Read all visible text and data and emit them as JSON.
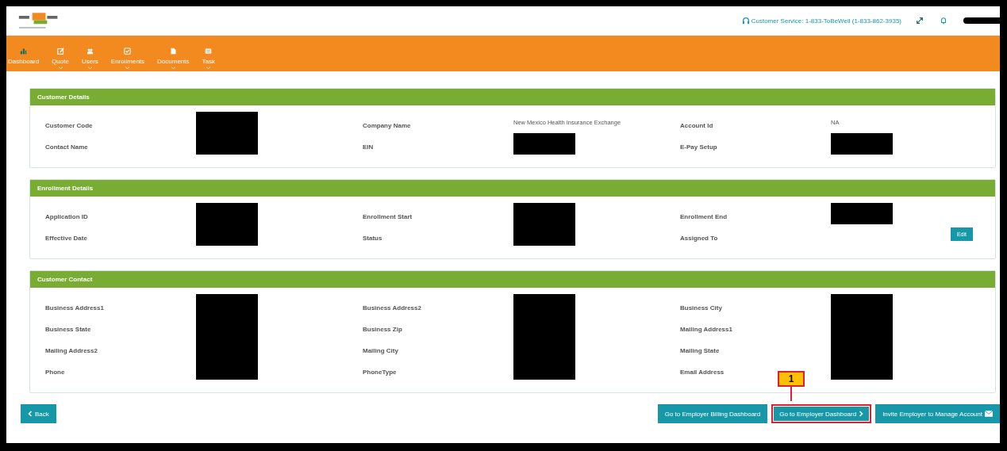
{
  "header": {
    "customer_service": "Customer Service: 1-833-ToBeWell (1-833-862-3935)",
    "user_redacted": true
  },
  "nav": [
    {
      "label": "Dashboard",
      "dropdown": false
    },
    {
      "label": "Quote",
      "dropdown": true
    },
    {
      "label": "Users",
      "dropdown": true
    },
    {
      "label": "Enrollments",
      "dropdown": true
    },
    {
      "label": "Documents",
      "dropdown": true
    },
    {
      "label": "Task",
      "dropdown": true
    }
  ],
  "sections": [
    {
      "title": "Customer Details",
      "rows": [
        [
          {
            "label": "Customer Code",
            "redacted": true
          },
          {
            "label": "Company Name",
            "value": "New Mexico Health Insurance Exchange",
            "redacted": false
          },
          {
            "label": "Account Id",
            "value": "NA",
            "redacted": false
          }
        ],
        [
          {
            "label": "Contact Name",
            "redacted": true
          },
          {
            "label": "EIN",
            "redacted": true
          },
          {
            "label": "E-Pay Setup",
            "redacted": true
          }
        ]
      ]
    },
    {
      "title": "Enrollment Details",
      "action": "Edit",
      "rows": [
        [
          {
            "label": "Application ID",
            "redacted": true
          },
          {
            "label": "Enrollment Start",
            "redacted": true
          },
          {
            "label": "Enrollment End",
            "redacted": true
          }
        ],
        [
          {
            "label": "Effective Date",
            "redacted": true
          },
          {
            "label": "Status",
            "redacted": true
          },
          {
            "label": "Assigned To",
            "redacted": false
          }
        ]
      ]
    },
    {
      "title": "Customer Contact",
      "rows": [
        [
          {
            "label": "Business Address1",
            "redacted": true
          },
          {
            "label": "Business Address2",
            "redacted": true
          },
          {
            "label": "Business City",
            "redacted": true
          }
        ],
        [
          {
            "label": "Business State",
            "redacted": true
          },
          {
            "label": "Business Zip",
            "redacted": true
          },
          {
            "label": "Mailing Address1",
            "redacted": true
          }
        ],
        [
          {
            "label": "Mailing Address2",
            "redacted": true
          },
          {
            "label": "Mailing City",
            "redacted": true
          },
          {
            "label": "Mailing State",
            "redacted": true
          }
        ],
        [
          {
            "label": "Phone",
            "redacted": true
          },
          {
            "label": "PhoneType",
            "redacted": true
          },
          {
            "label": "Email Address",
            "redacted": true
          }
        ]
      ]
    }
  ],
  "footer": {
    "back": {
      "label": "Back"
    },
    "buttons": [
      {
        "label": "Go to Employer Billing Dashboard",
        "highlighted": false
      },
      {
        "label": "Go to Employer Dashboard",
        "highlighted": true,
        "callout": "1"
      },
      {
        "label": "Invite Employer to Manage Account",
        "highlighted": false
      }
    ]
  }
}
